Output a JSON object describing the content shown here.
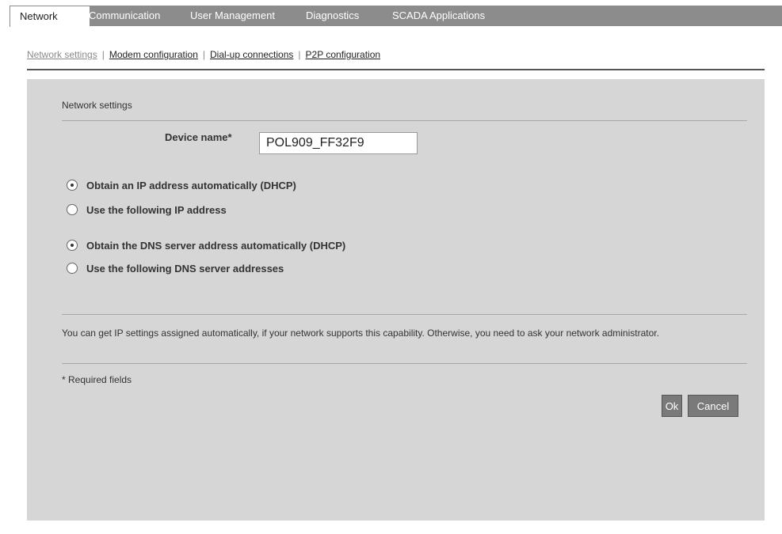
{
  "tabs": [
    "Network",
    "Communication",
    "User Management",
    "Diagnostics",
    "SCADA Applications"
  ],
  "subnav": {
    "links": [
      "Network settings",
      "Modem configuration",
      "Dial-up connections",
      "P2P configuration"
    ],
    "separator": "|"
  },
  "panel": {
    "title": "Network settings",
    "device_name_label": "Device name*",
    "device_name_value": "POL909_FF32F9",
    "ip_options": [
      {
        "label": "Obtain an IP address automatically (DHCP)",
        "checked": true
      },
      {
        "label": "Use the following IP address",
        "checked": false
      }
    ],
    "dns_options": [
      {
        "label": "Obtain the DNS server address automatically (DHCP)",
        "checked": true
      },
      {
        "label": "Use the following DNS server addresses",
        "checked": false
      }
    ],
    "hint": "You can get IP settings assigned automatically, if your network supports this capability. Otherwise, you need to ask your network administrator.",
    "required_note": "* Required fields",
    "ok_label": "Ok",
    "cancel_label": "Cancel"
  },
  "colors": {
    "tab_bar": "#8c8c8c",
    "panel_bg": "#d6d6d6",
    "button_bg": "#7a7a7a"
  }
}
